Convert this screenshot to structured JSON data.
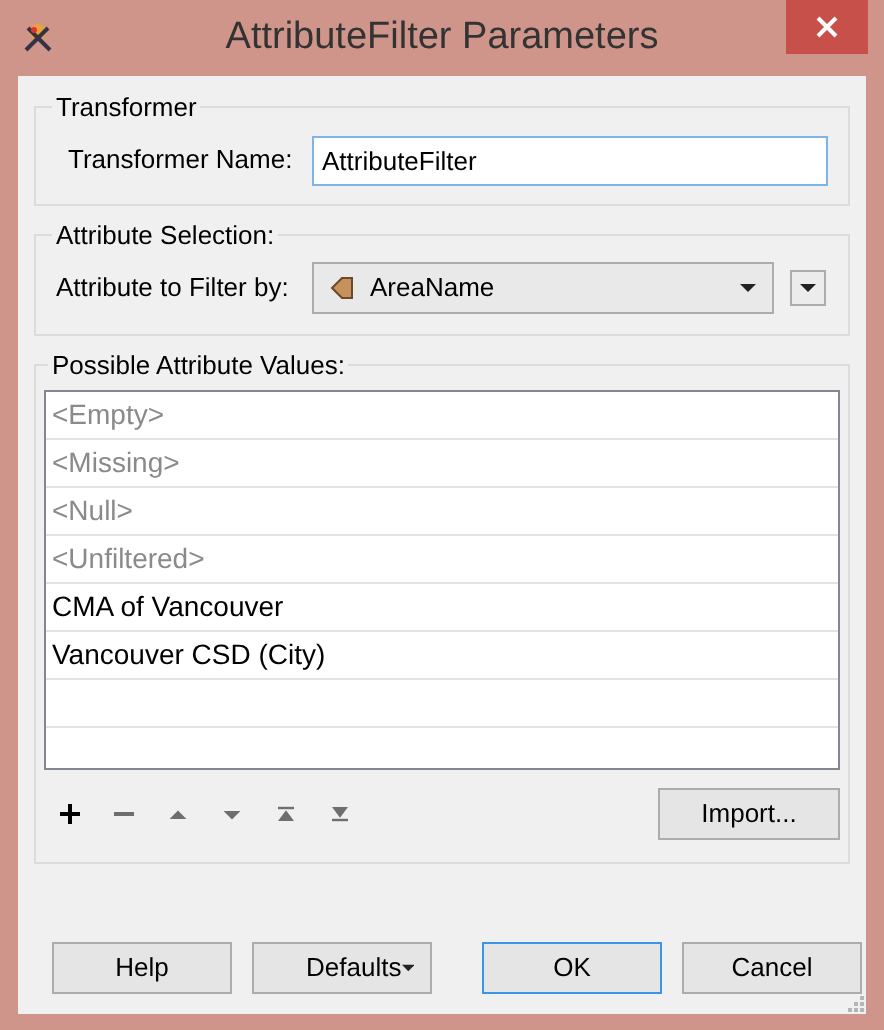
{
  "window": {
    "title": "AttributeFilter Parameters"
  },
  "transformer": {
    "legend": "Transformer",
    "label": "Transformer Name:",
    "value": "AttributeFilter"
  },
  "attribute_selection": {
    "legend": "Attribute Selection:",
    "label": "Attribute to Filter by:",
    "value": "AreaName"
  },
  "possible_values": {
    "legend": "Possible Attribute Values:",
    "items": [
      {
        "text": "<Empty>",
        "kind": "special"
      },
      {
        "text": "<Missing>",
        "kind": "special"
      },
      {
        "text": "<Null>",
        "kind": "special"
      },
      {
        "text": "<Unfiltered>",
        "kind": "special"
      },
      {
        "text": "CMA of Vancouver",
        "kind": "value"
      },
      {
        "text": "Vancouver CSD (City)",
        "kind": "value"
      }
    ],
    "toolbar": [
      {
        "kind": "add",
        "disabled": false
      },
      {
        "kind": "remove",
        "disabled": true
      },
      {
        "kind": "up",
        "disabled": true
      },
      {
        "kind": "down",
        "disabled": true
      },
      {
        "kind": "top",
        "disabled": true
      },
      {
        "kind": "bottom",
        "disabled": true
      }
    ],
    "import_button": "Import..."
  },
  "buttons": [
    {
      "label": "Help",
      "kind": "plain",
      "default": false
    },
    {
      "label": "Defaults",
      "kind": "menu",
      "default": false
    },
    {
      "label": "OK",
      "kind": "plain",
      "default": true
    },
    {
      "label": "Cancel",
      "kind": "plain",
      "default": false
    }
  ]
}
